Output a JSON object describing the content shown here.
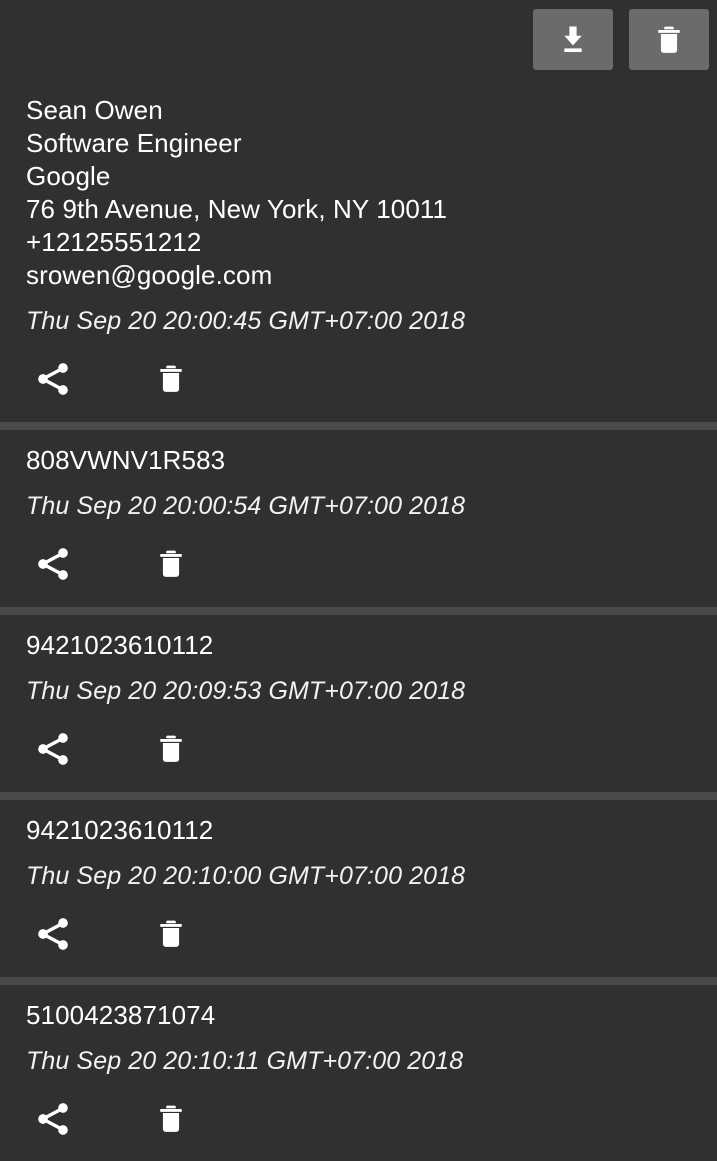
{
  "toolbar": {
    "buttons": [
      {
        "name": "save-history-button",
        "icon": "download-icon",
        "label": "Save history"
      },
      {
        "name": "clear-history-button",
        "icon": "trash-icon",
        "label": "Clear history"
      }
    ]
  },
  "colors": {
    "background": "#303030",
    "divider": "#4a4a4a",
    "button_background": "#6b6b6b",
    "text": "#ffffff"
  },
  "item_actions": [
    {
      "name": "share-button",
      "icon": "share-icon",
      "label": "Share"
    },
    {
      "name": "delete-button",
      "icon": "trash-icon",
      "label": "Delete"
    }
  ],
  "history": [
    {
      "contents": "Sean Owen\nSoftware Engineer\nGoogle\n76 9th Avenue, New York, NY 10011\n+12125551212\nsrowen@google.com",
      "timestamp": "Thu Sep 20 20:00:45 GMT+07:00 2018"
    },
    {
      "contents": "808VWNV1R583",
      "timestamp": "Thu Sep 20 20:00:54 GMT+07:00 2018"
    },
    {
      "contents": "9421023610112",
      "timestamp": "Thu Sep 20 20:09:53 GMT+07:00 2018"
    },
    {
      "contents": "9421023610112",
      "timestamp": "Thu Sep 20 20:10:00 GMT+07:00 2018"
    },
    {
      "contents": "5100423871074",
      "timestamp": "Thu Sep 20 20:10:11 GMT+07:00 2018"
    }
  ]
}
